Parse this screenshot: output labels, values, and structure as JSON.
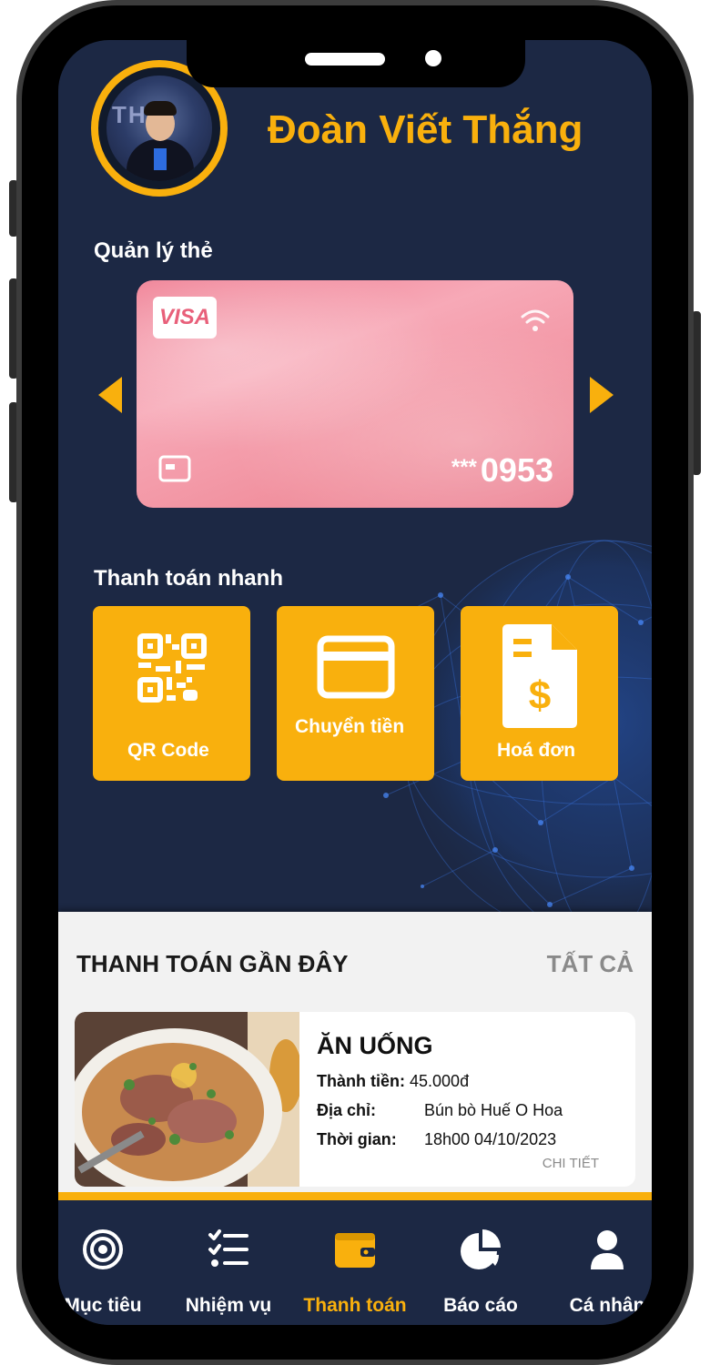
{
  "user": {
    "name": "Đoàn Viết Thắng"
  },
  "card_section": {
    "label": "Quản lý thẻ",
    "card": {
      "brand": "VISA",
      "masked_prefix": "***",
      "last4": "0953"
    }
  },
  "quick_pay": {
    "label": "Thanh toán nhanh",
    "items": [
      {
        "label": "QR Code",
        "icon": "qr-code-icon"
      },
      {
        "label": "Chuyển tiền",
        "icon": "credit-card-icon"
      },
      {
        "label": "Hoá đơn",
        "icon": "invoice-icon"
      }
    ]
  },
  "recent": {
    "title": "THANH TOÁN GẦN ĐÂY",
    "all_label": "TẤT CẢ",
    "transaction": {
      "category": "ĂN UỐNG",
      "amount_label": "Thành tiền:",
      "amount": "45.000đ",
      "address_label": "Địa chỉ:",
      "address": "Bún bò Huế O Hoa",
      "time_label": "Thời gian:",
      "time": "18h00 04/10/2023",
      "detail_label": "CHI TIẾT"
    }
  },
  "nav": {
    "items": [
      {
        "label": "Mục tiêu",
        "icon": "target-icon"
      },
      {
        "label": "Nhiệm vụ",
        "icon": "task-list-icon"
      },
      {
        "label": "Thanh toán",
        "icon": "wallet-icon",
        "active": true
      },
      {
        "label": "Báo cáo",
        "icon": "pie-chart-icon"
      },
      {
        "label": "Cá nhân",
        "icon": "user-icon"
      }
    ]
  },
  "colors": {
    "accent": "#f9b00d",
    "background": "#1c2844",
    "card": "#f19aa8",
    "panel": "#f2f2f2"
  }
}
